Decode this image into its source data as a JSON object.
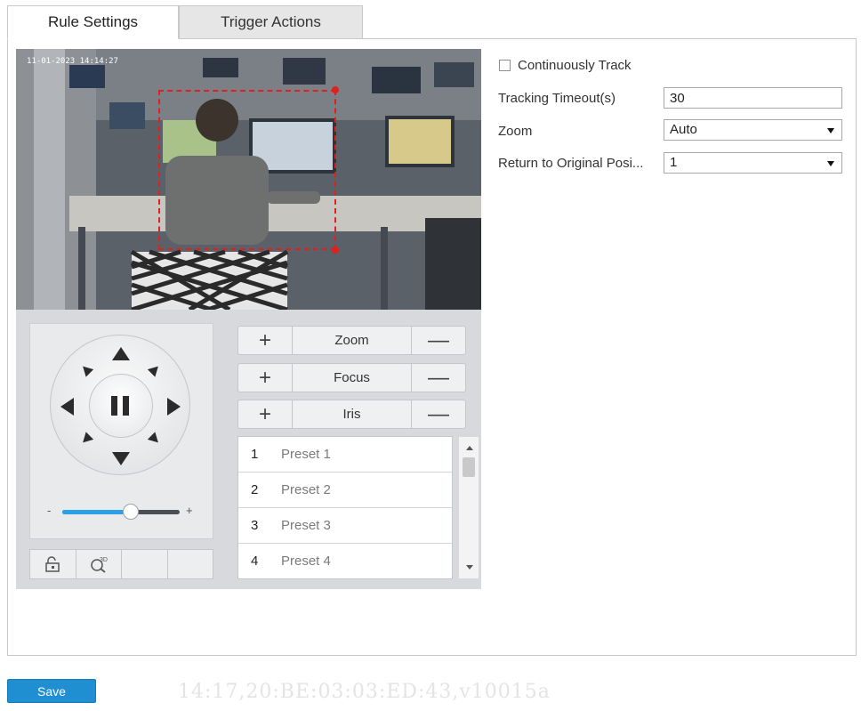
{
  "tabs": [
    {
      "label": "Rule Settings",
      "active": true
    },
    {
      "label": "Trigger Actions",
      "active": false
    }
  ],
  "video": {
    "osd_timestamp": "11-01-2023 14:14:27",
    "track_box_color": "#e02020"
  },
  "ptz": {
    "direction_icons": [
      "arrow-up-icon",
      "arrow-down-icon",
      "arrow-left-icon",
      "arrow-right-icon",
      "arrow-up-left-icon",
      "arrow-up-right-icon",
      "arrow-down-left-icon",
      "arrow-down-right-icon",
      "pause-icon"
    ],
    "speed": {
      "minus": "-",
      "plus": "+",
      "value_fraction": 0.58
    },
    "controls": [
      {
        "key": "zoom",
        "label": "Zoom",
        "plus": "+",
        "minus": "—"
      },
      {
        "key": "focus",
        "label": "Focus",
        "plus": "+",
        "minus": "—"
      },
      {
        "key": "iris",
        "label": "Iris",
        "plus": "+",
        "minus": "—"
      }
    ],
    "bottom_tools": [
      "lock-icon",
      "3d-zoom-icon"
    ],
    "presets": [
      {
        "num": "1",
        "name": "Preset 1"
      },
      {
        "num": "2",
        "name": "Preset 2"
      },
      {
        "num": "3",
        "name": "Preset 3"
      },
      {
        "num": "4",
        "name": "Preset 4"
      }
    ]
  },
  "settings": {
    "continuously_track": {
      "label": "Continuously Track",
      "checked": false
    },
    "tracking_timeout": {
      "label": "Tracking Timeout(s)",
      "value": "30"
    },
    "zoom": {
      "label": "Zoom",
      "value": "Auto"
    },
    "return_original": {
      "label": "Return to Original Posi...",
      "value": "1"
    }
  },
  "footer": {
    "save_label": "Save",
    "watermark": "14:17,20:BE:03:03:ED:43,v10015a"
  },
  "colors": {
    "accent": "#1f8fd1",
    "slider_fill": "#2aa1e6",
    "track_box": "#e02020"
  }
}
